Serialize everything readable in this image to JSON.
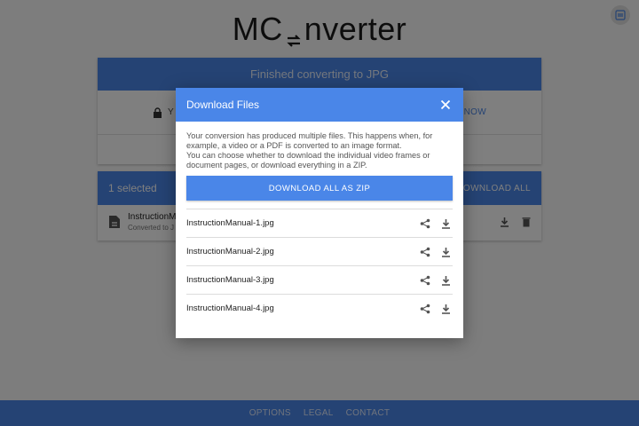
{
  "app": {
    "logo_prefix": "MC",
    "logo_suffix": "nverter",
    "corner_icon": "convert-icon"
  },
  "status_card": {
    "banner": "Finished converting to JPG",
    "lock_text": "Y",
    "link_text": "NOW"
  },
  "files_card": {
    "selected_label": "1 selected",
    "download_all_label": "DOWNLOAD ALL",
    "file_name": "InstructionMa",
    "file_subtitle": "Converted to J"
  },
  "dialog": {
    "title": "Download Files",
    "description_line1": "Your conversion has produced multiple files. This happens when, for example, a video or a PDF is converted to an image format.",
    "description_line2": "You can choose whether to download the individual video frames or document pages, or download everything in a ZIP.",
    "zip_button": "DOWNLOAD ALL AS ZIP",
    "files": [
      {
        "name": "InstructionManual-1.jpg"
      },
      {
        "name": "InstructionManual-2.jpg"
      },
      {
        "name": "InstructionManual-3.jpg"
      },
      {
        "name": "InstructionManual-4.jpg"
      }
    ]
  },
  "footer": {
    "links": [
      "OPTIONS",
      "LEGAL",
      "CONTACT"
    ]
  },
  "colors": {
    "accent": "#4a86e8",
    "overlay": "rgba(0,0,0,0.5)"
  }
}
